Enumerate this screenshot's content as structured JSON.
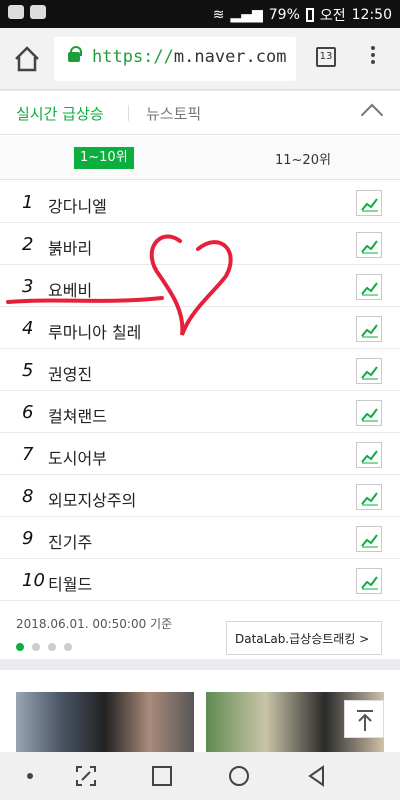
{
  "status": {
    "battery": "79%",
    "ampm": "오전",
    "time": "12:50"
  },
  "browser": {
    "url_scheme": "https://",
    "url_host": "m.naver.com",
    "tabs_count": "13"
  },
  "realtime": {
    "tabs": {
      "primary": "실시간 급상승",
      "secondary": "뉴스토픽"
    },
    "segments": {
      "first": "1~10위",
      "second": "11~20위"
    },
    "items": [
      {
        "rank": "1",
        "term": "강다니엘"
      },
      {
        "rank": "2",
        "term": "붉바리"
      },
      {
        "rank": "3",
        "term": "요베비"
      },
      {
        "rank": "4",
        "term": "루마니아 칠레"
      },
      {
        "rank": "5",
        "term": "권영진"
      },
      {
        "rank": "6",
        "term": "컬쳐랜드"
      },
      {
        "rank": "7",
        "term": "도시어부"
      },
      {
        "rank": "8",
        "term": "외모지상주의"
      },
      {
        "rank": "9",
        "term": "진기주"
      },
      {
        "rank": "10",
        "term": "티월드"
      }
    ],
    "basetime": "2018.06.01. 00:50:00 기준",
    "datalab": "DataLab.급상승트래킹 >"
  },
  "colors": {
    "accent": "#0cae3e",
    "annotation": "#e5203a"
  }
}
